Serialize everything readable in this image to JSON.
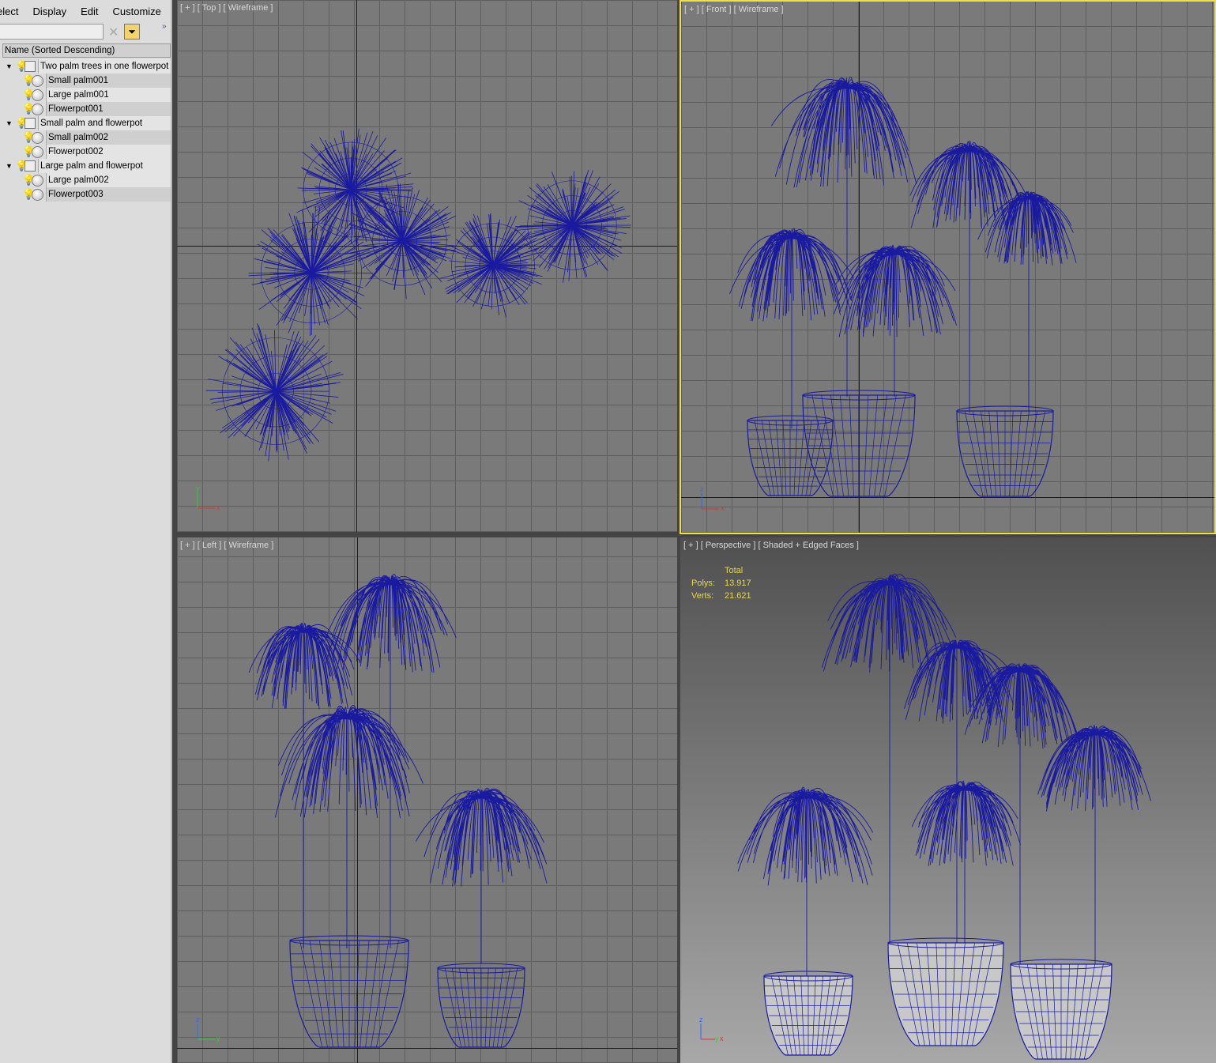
{
  "menu": [
    "elect",
    "Display",
    "Edit",
    "Customize"
  ],
  "search": {
    "value": "",
    "clear_icon": "close-x-icon",
    "filter_icon": "filter-icon",
    "more": "»"
  },
  "column_header": "Name (Sorted Descending)",
  "tree": [
    {
      "label": "Two palm trees in one flowerpot",
      "children": [
        "Small palm001",
        "Large palm001",
        "Flowerpot001"
      ]
    },
    {
      "label": "Small palm and flowerpot",
      "children": [
        "Small palm002",
        "Flowerpot002"
      ]
    },
    {
      "label": "Large palm and flowerpot",
      "children": [
        "Large palm002",
        "Flowerpot003"
      ]
    }
  ],
  "viewports": {
    "top": "[ + ] [ Top ] [ Wireframe ]",
    "front": "[ + ] [ Front ] [ Wireframe ]",
    "left": "[ + ] [ Left ] [ Wireframe ]",
    "perspective": "[ + ] [ Perspective ] [ Shaded + Edged Faces ]"
  },
  "stats": {
    "header": "Total",
    "polys_label": "Polys:",
    "polys": "13.917",
    "verts_label": "Verts:",
    "verts": "21.621"
  },
  "active_viewport": "front",
  "colors": {
    "wire": "#1a1aa0",
    "active_border": "#f0e040",
    "grid": "#7a7a7a",
    "stats": "#e6d84a"
  }
}
